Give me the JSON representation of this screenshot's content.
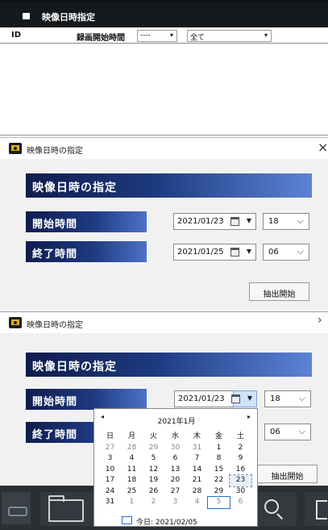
{
  "list_panel": {
    "title": "映像日時指定",
    "columns": {
      "id": "ID",
      "start": "録画開始時間"
    },
    "filter1": {
      "value": "----"
    },
    "filter2": {
      "value": "全て"
    }
  },
  "dialog": {
    "window_title": "映像日時の指定",
    "heading": "映像日時の指定",
    "start_label": "開始時間",
    "end_label": "終了時間",
    "button": "抽出開始",
    "close": "×"
  },
  "dialog_closed": {
    "start_date": "2021/01/23",
    "start_hour": "18",
    "end_date": "2021/01/25",
    "end_hour": "06"
  },
  "dialog_open": {
    "start_date": "2021/01/23",
    "start_hour": "18",
    "end_hour": "06",
    "close": "›"
  },
  "calendar": {
    "prev": "◂",
    "next": "▸",
    "month_title": "2021年1月",
    "weekdays": [
      "日",
      "月",
      "火",
      "水",
      "木",
      "金",
      "土"
    ],
    "weeks": [
      [
        "27",
        "28",
        "29",
        "30",
        "31",
        "1",
        "2"
      ],
      [
        "3",
        "4",
        "5",
        "6",
        "7",
        "8",
        "9"
      ],
      [
        "10",
        "11",
        "12",
        "13",
        "14",
        "15",
        "16"
      ],
      [
        "17",
        "18",
        "19",
        "20",
        "21",
        "22",
        "23"
      ],
      [
        "24",
        "25",
        "26",
        "27",
        "28",
        "29",
        "30"
      ],
      [
        "31",
        "1",
        "2",
        "3",
        "4",
        "5",
        "6"
      ]
    ],
    "today_text": "今日: 2021/02/05",
    "selected": "23"
  }
}
